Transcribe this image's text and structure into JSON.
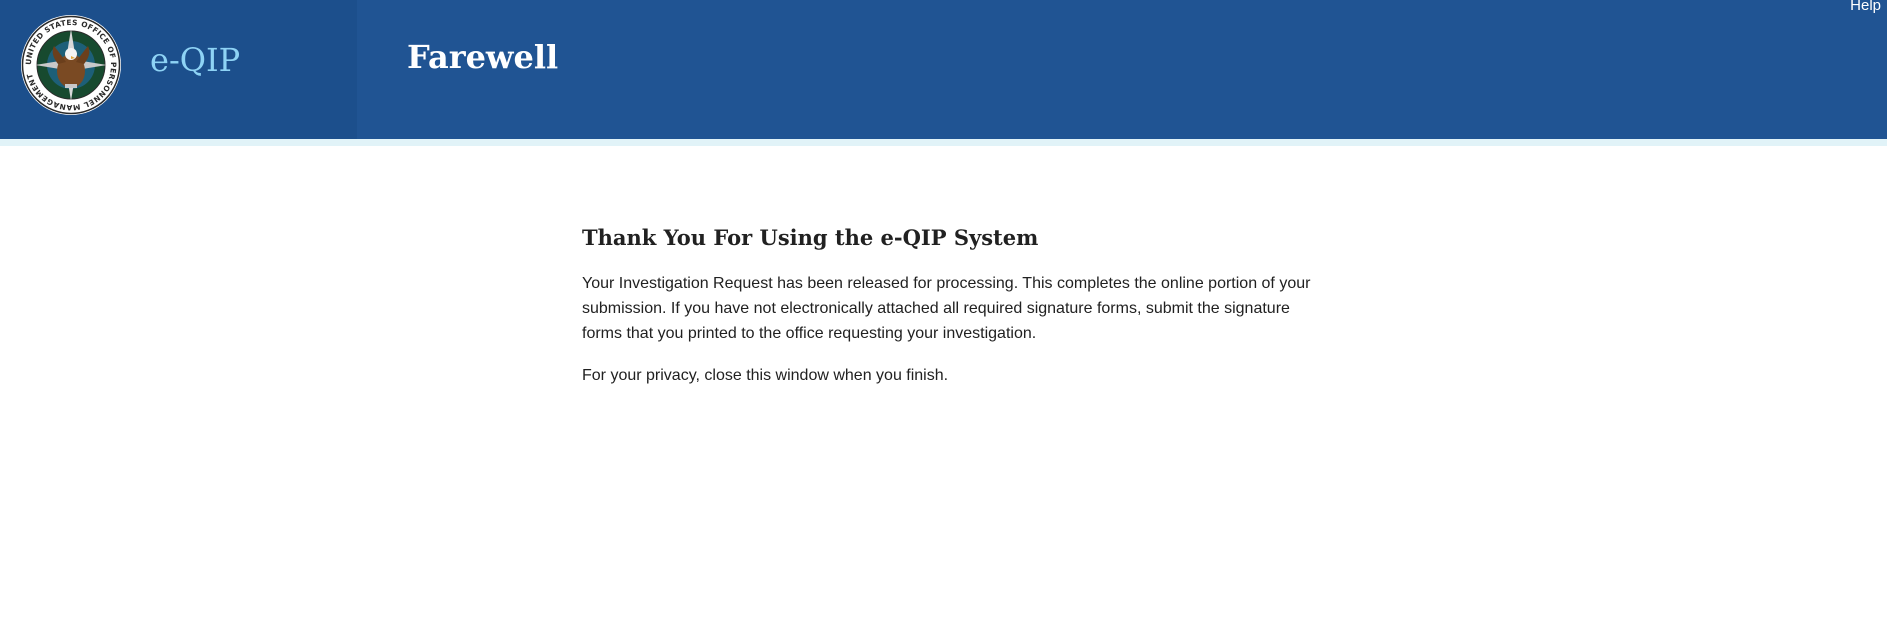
{
  "header": {
    "seal_icon": "opm-seal-icon",
    "seal_ring_text": "UNITED STATES OFFICE OF PERSONNEL MANAGEMENT",
    "app_name": "e-QIP",
    "page_title": "Farewell",
    "help_label": "Help"
  },
  "main": {
    "heading": "Thank You For Using the e-QIP System",
    "paragraph_1": "Your Investigation Request has been released for processing. This completes the online portion of your submission. If you have not electronically attached all required signature forms, submit the signature forms that you printed to the office requesting your investigation.",
    "paragraph_2": "For your privacy, close this window when you finish."
  },
  "colors": {
    "header_bg": "#205493",
    "brand_panel_bg": "#1c4f8c",
    "app_name": "#8ed3f5",
    "stripe": "#e1f3f8",
    "body_text": "#212121"
  }
}
